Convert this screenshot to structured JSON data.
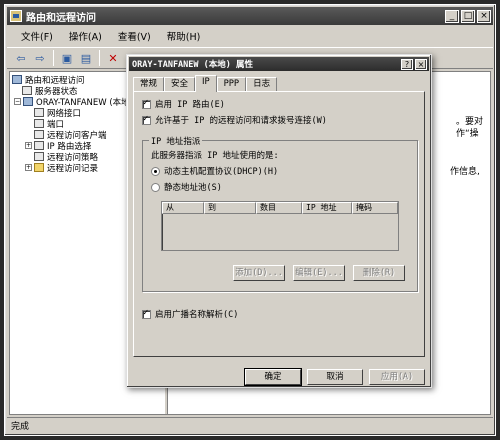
{
  "window": {
    "title": "路由和远程访问"
  },
  "menu": [
    "文件(F)",
    "操作(A)",
    "查看(V)",
    "帮助(H)"
  ],
  "toolbar": {
    "icons": [
      "back-arrow-icon",
      "forward-arrow-icon",
      "up-folder-icon",
      "show-tree-icon",
      "delete-icon",
      "properties-icon"
    ]
  },
  "tree": {
    "items": [
      {
        "label": "路由和远程访问",
        "icon": "router-icon"
      },
      {
        "label": "服务器状态",
        "icon": "server-status-icon"
      },
      {
        "label": "ORAY-TANFANEW (本地)",
        "icon": "server-icon"
      },
      {
        "label": "网络接口",
        "icon": "network-interface-icon"
      },
      {
        "label": "端口",
        "icon": "port-icon"
      },
      {
        "label": "远程访问客户端",
        "icon": "client-icon"
      },
      {
        "label": "IP 路由选择",
        "icon": "routing-icon"
      },
      {
        "label": "远程访问策略",
        "icon": "policy-icon"
      },
      {
        "label": "远程访问记录",
        "icon": "folder-icon"
      }
    ]
  },
  "right_pane": {
    "fragment_1": "。要对",
    "fragment_2": "作“操",
    "fragment_3": "作信息,"
  },
  "status_bar": "完成",
  "dialog": {
    "title": "ORAY-TANFANEW (本地) 属性",
    "help_button": "?",
    "close_button": "×",
    "tabs": [
      "常规",
      "安全",
      "IP",
      "PPP",
      "日志"
    ],
    "active_tab": "IP",
    "enable_ip_routing": "启用 IP 路由(E)",
    "enable_ip_routing_checked": true,
    "allow_ip_remote_access": "允许基于 IP 的远程访问和请求拨号连接(W)",
    "allow_ip_remote_access_checked": true,
    "ip_assignment": {
      "legend": "IP 地址指派",
      "prompt": "此服务器指派 IP 地址使用的是:",
      "dhcp_label": "动态主机配置协议(DHCP)(H)",
      "dhcp_selected": true,
      "static_pool_label": "静态地址池(S)",
      "static_pool_selected": false,
      "columns": [
        "从",
        "到",
        "数目",
        "IP 地址",
        "掩码"
      ],
      "add_button": "添加(D)...",
      "edit_button": "编辑(E)...",
      "remove_button": "删除(R)"
    },
    "broadcast_name_resolution": "启用广播名称解析(C)",
    "broadcast_name_resolution_checked": true,
    "ok_button": "确定",
    "cancel_button": "取消",
    "apply_button": "应用(A)"
  }
}
